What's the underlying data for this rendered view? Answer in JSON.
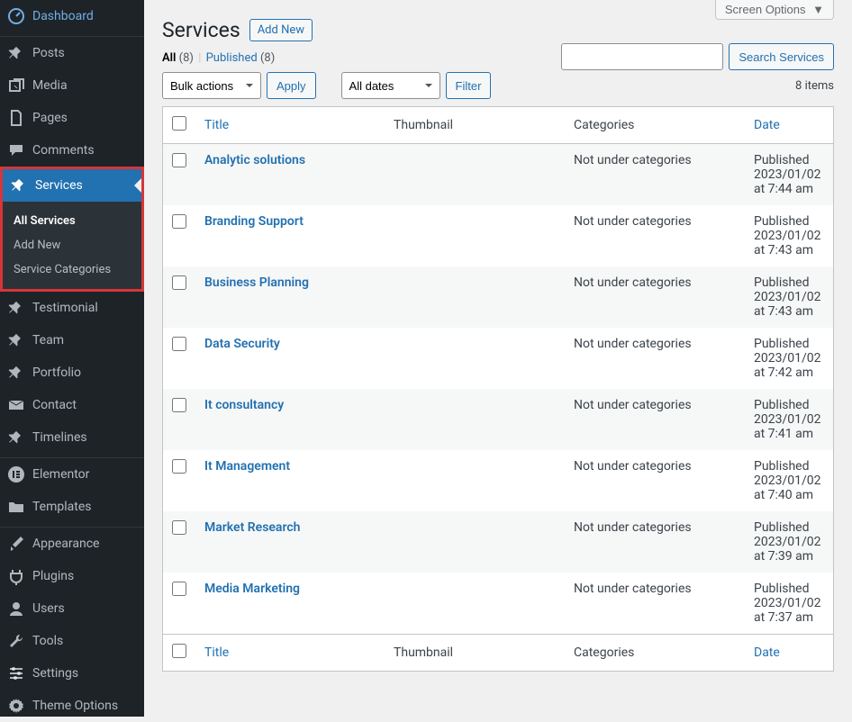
{
  "screen_options_label": "Screen Options",
  "page_title": "Services",
  "add_new_label": "Add New",
  "views": {
    "all_label": "All",
    "all_count": "(8)",
    "published_label": "Published",
    "published_count": "(8)"
  },
  "bulk_actions_label": "Bulk actions",
  "apply_label": "Apply",
  "all_dates_label": "All dates",
  "filter_label": "Filter",
  "items_count_label": "8 items",
  "search_button_label": "Search Services",
  "columns": {
    "title": "Title",
    "thumbnail": "Thumbnail",
    "categories": "Categories",
    "date": "Date"
  },
  "no_categories_text": "Not under categories",
  "rows": [
    {
      "title": "Analytic solutions",
      "categories": "Not under categories",
      "date_state": "Published",
      "date": "2023/01/02 at 7:44 am"
    },
    {
      "title": "Branding Support",
      "categories": "Not under categories",
      "date_state": "Published",
      "date": "2023/01/02 at 7:43 am"
    },
    {
      "title": "Business Planning",
      "categories": "Not under categories",
      "date_state": "Published",
      "date": "2023/01/02 at 7:43 am"
    },
    {
      "title": "Data Security",
      "categories": "Not under categories",
      "date_state": "Published",
      "date": "2023/01/02 at 7:42 am"
    },
    {
      "title": "It consultancy",
      "categories": "Not under categories",
      "date_state": "Published",
      "date": "2023/01/02 at 7:41 am"
    },
    {
      "title": "It Management",
      "categories": "Not under categories",
      "date_state": "Published",
      "date": "2023/01/02 at 7:40 am"
    },
    {
      "title": "Market Research",
      "categories": "Not under categories",
      "date_state": "Published",
      "date": "2023/01/02 at 7:39 am"
    },
    {
      "title": "Media Marketing",
      "categories": "Not under categories",
      "date_state": "Published",
      "date": "2023/01/02 at 7:37 am"
    }
  ],
  "sidebar": {
    "dashboard": "Dashboard",
    "posts": "Posts",
    "media": "Media",
    "pages": "Pages",
    "comments": "Comments",
    "services": "Services",
    "services_sub": {
      "all": "All Services",
      "add": "Add New",
      "cats": "Service Categories"
    },
    "testimonial": "Testimonial",
    "team": "Team",
    "portfolio": "Portfolio",
    "contact": "Contact",
    "timelines": "Timelines",
    "elementor": "Elementor",
    "templates": "Templates",
    "appearance": "Appearance",
    "plugins": "Plugins",
    "users": "Users",
    "tools": "Tools",
    "settings": "Settings",
    "theme_options": "Theme Options"
  }
}
